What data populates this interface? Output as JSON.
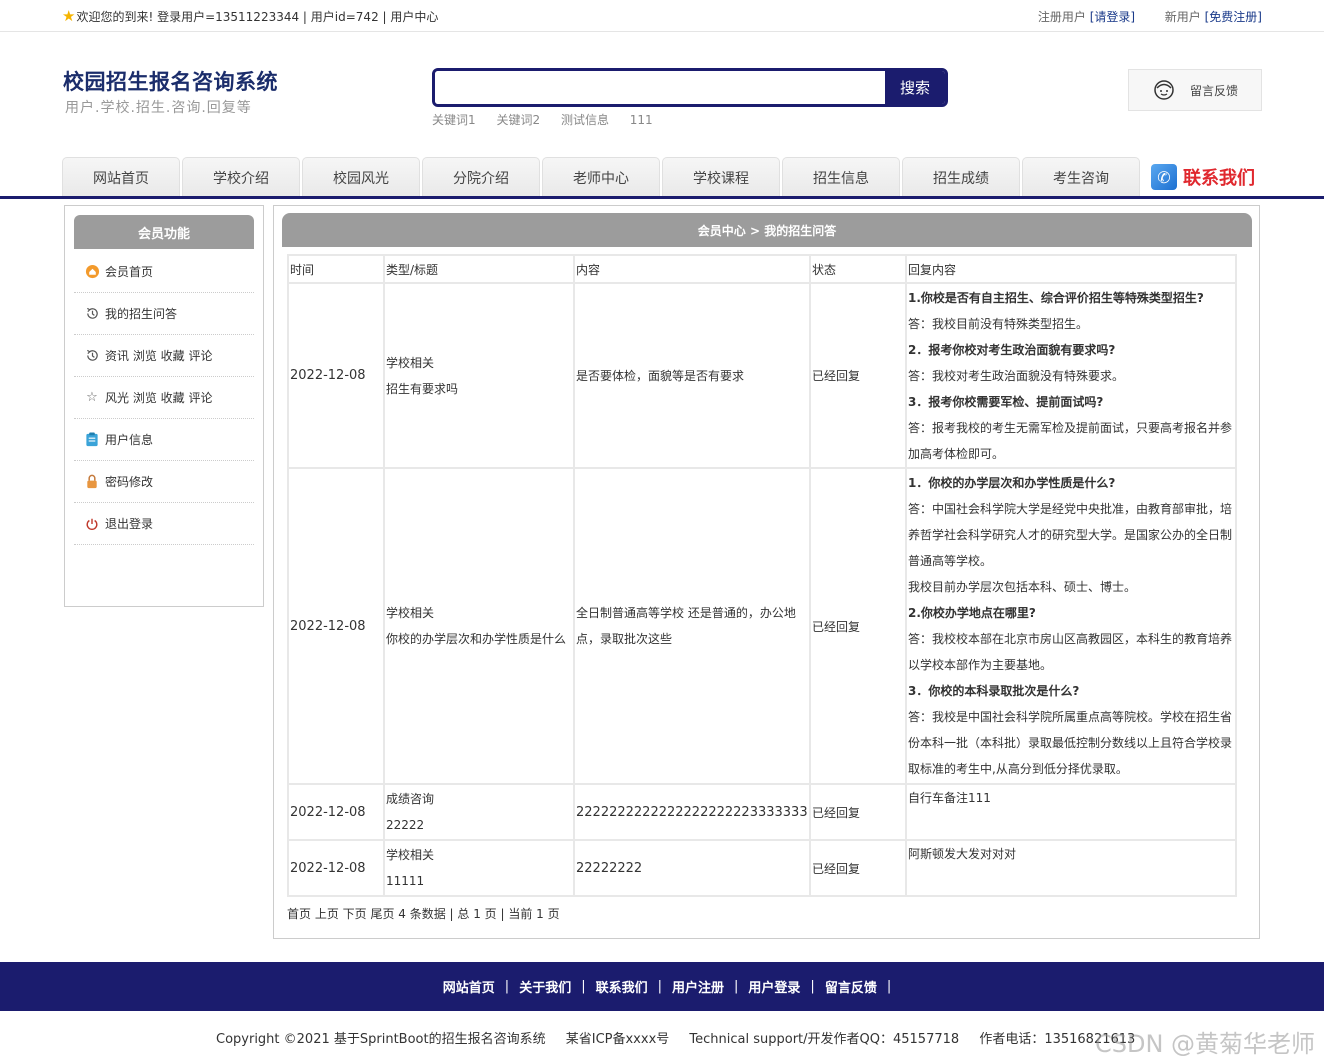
{
  "topbar": {
    "welcome": "欢迎您的到来!  登录用户=13511223344 | 用户id=742 | 用户中心",
    "registered_user": "注册用户",
    "login_link": "[请登录]",
    "new_user": "新用户",
    "register_link": "[免费注册]"
  },
  "header": {
    "title": "校园招生报名咨询系统",
    "subtitle": "用户.学校.招生.咨询.回复等",
    "search_placeholder": "",
    "search_button": "搜索",
    "hotwords": [
      "关键词1",
      "关键词2",
      "测试信息",
      "111"
    ],
    "feedback": "留言反馈"
  },
  "nav": {
    "tabs": [
      "网站首页",
      "学校介绍",
      "校园风光",
      "分院介绍",
      "老师中心",
      "学校课程",
      "招生信息",
      "招生成绩",
      "考生咨询"
    ],
    "contact": "联系我们"
  },
  "sidebar": {
    "title": "会员功能",
    "items": [
      {
        "label": "会员首页",
        "icon": "home-orange-icon"
      },
      {
        "label": "我的招生问答",
        "icon": "history-icon"
      },
      {
        "label": "资讯 浏览 收藏 评论",
        "icon": "history-icon"
      },
      {
        "label": "风光 浏览 收藏 评论",
        "icon": "star-outline-icon"
      },
      {
        "label": "用户信息",
        "icon": "clipboard-icon"
      },
      {
        "label": "密码修改",
        "icon": "lock-icon"
      },
      {
        "label": "退出登录",
        "icon": "power-icon"
      }
    ]
  },
  "panel": {
    "breadcrumb": "会员中心 > 我的招生问答",
    "columns": [
      "时间",
      "类型/标题",
      "内容",
      "状态",
      "回复内容"
    ],
    "rows": [
      {
        "date": "2022-12-08",
        "type": "学校相关",
        "title": "招生有要求吗",
        "content": "是否要体检，面貌等是否有要求",
        "status": "已经回复",
        "reply": [
          {
            "q": true,
            "text": "1.你校是否有自主招生、综合评价招生等特殊类型招生?"
          },
          {
            "q": false,
            "text": "答：我校目前没有特殊类型招生。"
          },
          {
            "q": true,
            "text": "2．报考你校对考生政治面貌有要求吗?"
          },
          {
            "q": false,
            "text": "答：我校对考生政治面貌没有特殊要求。"
          },
          {
            "q": true,
            "text": "3．报考你校需要军检、提前面试吗?"
          },
          {
            "q": false,
            "text": "答：报考我校的考生无需军检及提前面试，只要高考报名并参加高考体检即可。"
          }
        ]
      },
      {
        "date": "2022-12-08",
        "type": "学校相关",
        "title": "你校的办学层次和办学性质是什么",
        "content": "全日制普通高等学校 还是普通的，办公地点，录取批次这些",
        "status": "已经回复",
        "reply": [
          {
            "q": true,
            "text": "1．你校的办学层次和办学性质是什么?"
          },
          {
            "q": false,
            "text": "答：中国社会科学院大学是经党中央批准，由教育部审批，培养哲学社会科学研究人才的研究型大学。是国家公办的全日制普通高等学校。"
          },
          {
            "q": false,
            "text": "我校目前办学层次包括本科、硕士、博士。"
          },
          {
            "q": true,
            "text": "2.你校办学地点在哪里?"
          },
          {
            "q": false,
            "text": "答：我校校本部在北京市房山区高教园区，本科生的教育培养以学校本部作为主要基地。"
          },
          {
            "q": true,
            "text": "3．你校的本科录取批次是什么?"
          },
          {
            "q": false,
            "text": "答：我校是中国社会科学院所属重点高等院校。学校在招生省份本科一批（本科批）录取最低控制分数线以上且符合学校录取标准的考生中,从高分到低分择优录取。"
          }
        ]
      },
      {
        "date": "2022-12-08",
        "type": "成绩咨询",
        "title": "22222",
        "content": "2222222222222222222223333333",
        "status": "已经回复",
        "reply": [
          {
            "q": false,
            "text": "自行车备注111"
          }
        ]
      },
      {
        "date": "2022-12-08",
        "type": "学校相关",
        "title": "11111",
        "content": "22222222",
        "status": "已经回复",
        "reply": [
          {
            "q": false,
            "text": "阿斯顿发大发对对对"
          }
        ]
      }
    ],
    "pager": "首页 上页 下页 尾页 4 条数据 | 总 1 页 | 当前 1 页"
  },
  "footer": {
    "links": [
      "网站首页",
      "关于我们",
      "联系我们",
      "用户注册",
      "用户登录",
      "留言反馈"
    ],
    "copyright": "Copyright ©2021 基于SprintBoot的招生报名咨询系统",
    "icp": "某省ICP备xxxx号",
    "support": "Technical support/开发作者QQ：45157718",
    "phone": "作者电话：13516821613",
    "watermark": "CSDN @黄菊华老师"
  }
}
